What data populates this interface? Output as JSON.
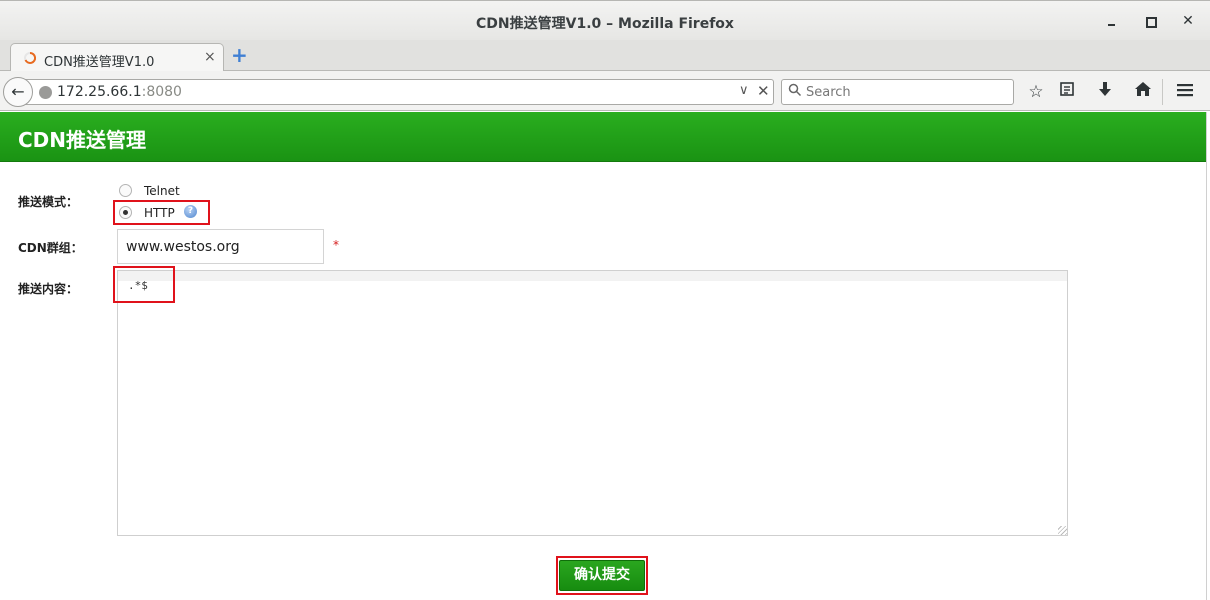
{
  "window": {
    "title": "CDN推送管理V1.0 – Mozilla Firefox",
    "controls": {
      "minimize": "minimize-icon",
      "maximize": "maximize-icon",
      "close": "close-icon"
    }
  },
  "tabs": [
    {
      "label": "CDN推送管理V1.0",
      "active": true,
      "close_glyph": "×"
    }
  ],
  "new_tab_glyph": "+",
  "navbar": {
    "url_host": "172.25.66.1",
    "url_port": ":8080",
    "search_placeholder": "Search",
    "icons": [
      "back-icon",
      "globe-icon",
      "dropdown-icon",
      "clear-icon",
      "search-icon",
      "bookmark-star-icon",
      "reader-icon",
      "download-icon",
      "home-icon",
      "menu-icon"
    ]
  },
  "page": {
    "header_title": "CDN推送管理",
    "accent_color": "#1f9e17",
    "highlight_color": "#e0121b",
    "form": {
      "mode_label": "推送模式：",
      "mode_options": [
        {
          "label": "Telnet",
          "selected": false
        },
        {
          "label": "HTTP",
          "selected": true,
          "help_icon": "help-icon"
        }
      ],
      "group_label": "CDN群组：",
      "group_value": "www.westos.org",
      "required_mark": "*",
      "content_label": "推送内容：",
      "content_value": ".*$",
      "submit_label": "确认提交"
    }
  }
}
